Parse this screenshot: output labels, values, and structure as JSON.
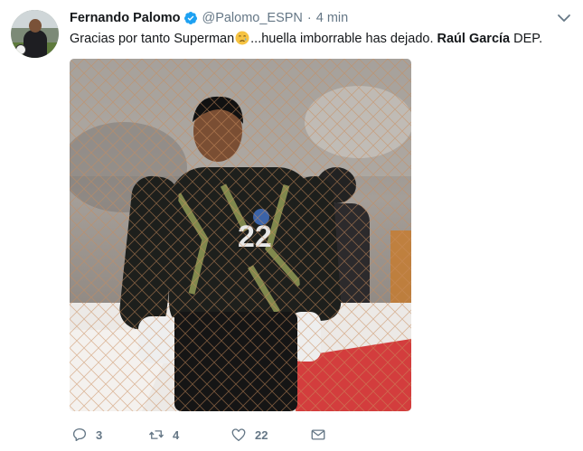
{
  "author": {
    "name": "Fernando Palomo",
    "handle": "@Palomo_ESPN",
    "separator": "·",
    "timestamp": "4 min"
  },
  "tweet": {
    "text_before_emoji": "Gracias por tanto Superman",
    "text_after_emoji": "...huella imborrable has dejado. ",
    "bold_name": "Raúl García",
    "text_end": " DEP.",
    "emoji": "crying-face-icon",
    "media": {
      "jersey_number": "22"
    }
  },
  "actions": {
    "reply_count": "3",
    "retweet_count": "4",
    "like_count": "22"
  },
  "colors": {
    "verified_blue": "#1da1f2",
    "muted_text": "#657786",
    "primary_text": "#14171a"
  }
}
